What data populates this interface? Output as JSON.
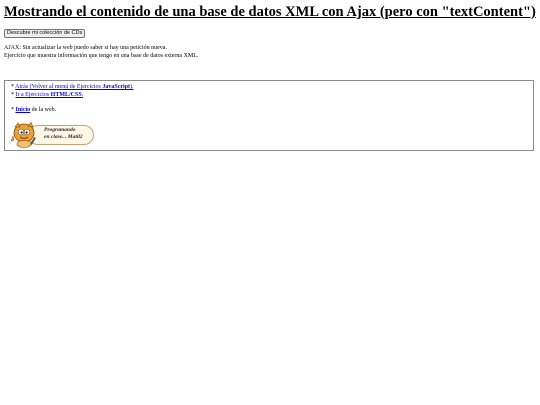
{
  "page": {
    "title": "Mostrando el contenido de una base de datos XML con Ajax (pero con \"textContent\")",
    "button_label": "Descubre mi colección de CDs",
    "intro_lines": [
      "AJAX: Sin actualizar la web puedo saber si hay una petición nueva.",
      "Ejercicio que muestra información que tengo en una base de datos externa XML."
    ]
  },
  "nav": {
    "back": {
      "prefix": "* ",
      "link_before": "Atrás (Volver al menú de Ejercicios ",
      "link_bold": "JavaScript",
      "link_after": ")."
    },
    "html_css": {
      "prefix": "* ",
      "link_before": "Ir a Ejercicios ",
      "link_bold": "HTML/CSS",
      "link_after": "."
    },
    "home": {
      "prefix": "* ",
      "link_bold": "Inicio",
      "link_after": " de la web."
    }
  },
  "badge": {
    "line1": "Programando",
    "line2": "en clase... Matil2"
  },
  "colors": {
    "link": "#0000ee",
    "box_border": "#8a8a8a",
    "badge_border": "#c8a06a",
    "character_orange": "#f0a030"
  }
}
